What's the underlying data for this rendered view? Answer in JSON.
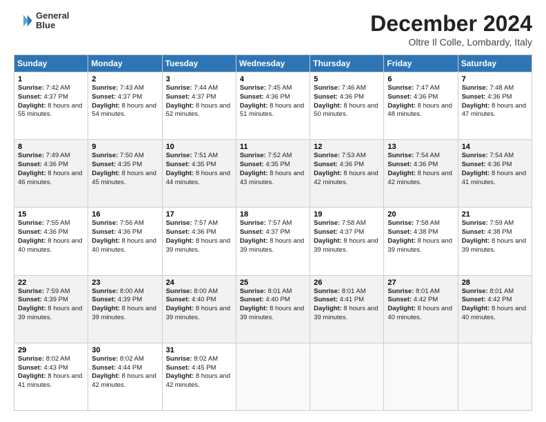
{
  "header": {
    "logo_line1": "General",
    "logo_line2": "Blue",
    "main_title": "December 2024",
    "subtitle": "Oltre Il Colle, Lombardy, Italy"
  },
  "days_of_week": [
    "Sunday",
    "Monday",
    "Tuesday",
    "Wednesday",
    "Thursday",
    "Friday",
    "Saturday"
  ],
  "weeks": [
    [
      {
        "day": 1,
        "info": "Sunrise: 7:42 AM\nSunset: 4:37 PM\nDaylight: 8 hours and 55 minutes."
      },
      {
        "day": 2,
        "info": "Sunrise: 7:43 AM\nSunset: 4:37 PM\nDaylight: 8 hours and 54 minutes."
      },
      {
        "day": 3,
        "info": "Sunrise: 7:44 AM\nSunset: 4:37 PM\nDaylight: 8 hours and 52 minutes."
      },
      {
        "day": 4,
        "info": "Sunrise: 7:45 AM\nSunset: 4:36 PM\nDaylight: 8 hours and 51 minutes."
      },
      {
        "day": 5,
        "info": "Sunrise: 7:46 AM\nSunset: 4:36 PM\nDaylight: 8 hours and 50 minutes."
      },
      {
        "day": 6,
        "info": "Sunrise: 7:47 AM\nSunset: 4:36 PM\nDaylight: 8 hours and 48 minutes."
      },
      {
        "day": 7,
        "info": "Sunrise: 7:48 AM\nSunset: 4:36 PM\nDaylight: 8 hours and 47 minutes."
      }
    ],
    [
      {
        "day": 8,
        "info": "Sunrise: 7:49 AM\nSunset: 4:36 PM\nDaylight: 8 hours and 46 minutes."
      },
      {
        "day": 9,
        "info": "Sunrise: 7:50 AM\nSunset: 4:35 PM\nDaylight: 8 hours and 45 minutes."
      },
      {
        "day": 10,
        "info": "Sunrise: 7:51 AM\nSunset: 4:35 PM\nDaylight: 8 hours and 44 minutes."
      },
      {
        "day": 11,
        "info": "Sunrise: 7:52 AM\nSunset: 4:35 PM\nDaylight: 8 hours and 43 minutes."
      },
      {
        "day": 12,
        "info": "Sunrise: 7:53 AM\nSunset: 4:36 PM\nDaylight: 8 hours and 42 minutes."
      },
      {
        "day": 13,
        "info": "Sunrise: 7:54 AM\nSunset: 4:36 PM\nDaylight: 8 hours and 42 minutes."
      },
      {
        "day": 14,
        "info": "Sunrise: 7:54 AM\nSunset: 4:36 PM\nDaylight: 8 hours and 41 minutes."
      }
    ],
    [
      {
        "day": 15,
        "info": "Sunrise: 7:55 AM\nSunset: 4:36 PM\nDaylight: 8 hours and 40 minutes."
      },
      {
        "day": 16,
        "info": "Sunrise: 7:56 AM\nSunset: 4:36 PM\nDaylight: 8 hours and 40 minutes."
      },
      {
        "day": 17,
        "info": "Sunrise: 7:57 AM\nSunset: 4:36 PM\nDaylight: 8 hours and 39 minutes."
      },
      {
        "day": 18,
        "info": "Sunrise: 7:57 AM\nSunset: 4:37 PM\nDaylight: 8 hours and 39 minutes."
      },
      {
        "day": 19,
        "info": "Sunrise: 7:58 AM\nSunset: 4:37 PM\nDaylight: 8 hours and 39 minutes."
      },
      {
        "day": 20,
        "info": "Sunrise: 7:58 AM\nSunset: 4:38 PM\nDaylight: 8 hours and 39 minutes."
      },
      {
        "day": 21,
        "info": "Sunrise: 7:59 AM\nSunset: 4:38 PM\nDaylight: 8 hours and 39 minutes."
      }
    ],
    [
      {
        "day": 22,
        "info": "Sunrise: 7:59 AM\nSunset: 4:39 PM\nDaylight: 8 hours and 39 minutes."
      },
      {
        "day": 23,
        "info": "Sunrise: 8:00 AM\nSunset: 4:39 PM\nDaylight: 8 hours and 39 minutes."
      },
      {
        "day": 24,
        "info": "Sunrise: 8:00 AM\nSunset: 4:40 PM\nDaylight: 8 hours and 39 minutes."
      },
      {
        "day": 25,
        "info": "Sunrise: 8:01 AM\nSunset: 4:40 PM\nDaylight: 8 hours and 39 minutes."
      },
      {
        "day": 26,
        "info": "Sunrise: 8:01 AM\nSunset: 4:41 PM\nDaylight: 8 hours and 39 minutes."
      },
      {
        "day": 27,
        "info": "Sunrise: 8:01 AM\nSunset: 4:42 PM\nDaylight: 8 hours and 40 minutes."
      },
      {
        "day": 28,
        "info": "Sunrise: 8:01 AM\nSunset: 4:42 PM\nDaylight: 8 hours and 40 minutes."
      }
    ],
    [
      {
        "day": 29,
        "info": "Sunrise: 8:02 AM\nSunset: 4:43 PM\nDaylight: 8 hours and 41 minutes."
      },
      {
        "day": 30,
        "info": "Sunrise: 8:02 AM\nSunset: 4:44 PM\nDaylight: 8 hours and 42 minutes."
      },
      {
        "day": 31,
        "info": "Sunrise: 8:02 AM\nSunset: 4:45 PM\nDaylight: 8 hours and 42 minutes."
      },
      null,
      null,
      null,
      null
    ]
  ]
}
